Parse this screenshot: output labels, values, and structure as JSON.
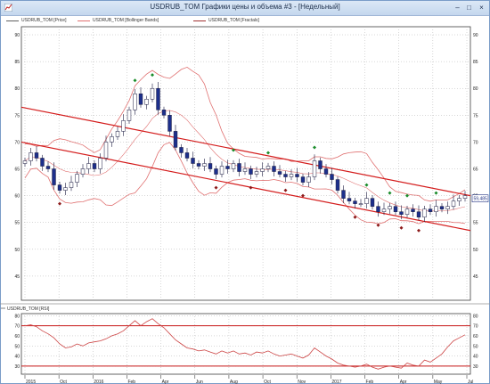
{
  "window": {
    "title": "USDRUB_TOM Графики цены и объема #3 - [Недельный]",
    "buttons": {
      "minimize": "–",
      "maximize": "□",
      "close": "×"
    }
  },
  "legend": {
    "price": "USDRUB_TOM [Price]",
    "bollinger": "USDRUB_TOM [Bollinger Bands]",
    "fractals": "USDRUB_TOM [Fractals]"
  },
  "rsi_panel": {
    "label": "USDRUB_TOM [RSI]",
    "levels": [
      70,
      30
    ]
  },
  "price_panel": {
    "last_price_label": "59,485"
  },
  "colors": {
    "candle_up": "#ffffff",
    "candle_down": "#1c2f8c",
    "bollinger": "#e07070",
    "trend": "#d41c1c",
    "fractal_up": "#1a8c2a",
    "fractal_down": "#8c1a1a",
    "rsi_line": "#cc4444",
    "rsi_levels": "#c81818"
  },
  "chart_data": [
    {
      "type": "candlestick",
      "title": "USDRUB_TOM",
      "y_ticks": [
        45,
        50,
        55,
        60,
        65,
        70,
        75,
        80,
        85,
        90
      ],
      "ylim": [
        40.5,
        91.5
      ],
      "x_ticks": [
        "2015",
        "Oct",
        "2016",
        "Feb",
        "Apr",
        "Jun",
        "Aug",
        "Oct",
        "Nov",
        "2017",
        "Feb",
        "Apr",
        "May",
        "Jul"
      ],
      "closes": [
        66.5,
        68,
        67,
        65.5,
        65,
        62,
        61,
        61.5,
        62.5,
        64,
        65,
        66,
        65,
        67,
        70,
        71,
        72,
        74,
        76,
        79,
        77,
        78,
        80,
        76,
        75,
        72,
        69,
        68,
        67,
        66,
        65.5,
        66,
        65,
        64,
        65.5,
        65,
        66,
        64.5,
        65,
        64,
        64.5,
        65,
        65.5,
        64.5,
        64,
        63.5,
        64,
        63.5,
        62.5,
        63.5,
        66.5,
        65,
        64,
        63,
        61,
        59.5,
        59,
        58.5,
        58.5,
        59.5,
        58,
        57,
        57.5,
        58,
        57,
        56.5,
        57.5,
        57,
        56,
        57.5,
        57,
        58,
        57.5,
        58,
        59,
        59.5,
        60
      ],
      "trend_upper": {
        "start": 76.5,
        "end": 60
      },
      "trend_lower": {
        "start": 70,
        "end": 53.5
      },
      "last_price": 59.485
    },
    {
      "type": "line",
      "title": "USDRUB_TOM [RSI]",
      "y_ticks": [
        30,
        40,
        50,
        60,
        70,
        80
      ],
      "ylim": [
        22,
        82
      ],
      "levels": [
        70,
        30
      ],
      "values": [
        70,
        71,
        69,
        65,
        62,
        58,
        52,
        48,
        49,
        52,
        50,
        53,
        54,
        55,
        57,
        60,
        62,
        65,
        70,
        75,
        70,
        74,
        77,
        72,
        68,
        62,
        56,
        52,
        48,
        47,
        45,
        46,
        44,
        42,
        45,
        43,
        45,
        42,
        43,
        41,
        44,
        43,
        45,
        42,
        40,
        41,
        42,
        40,
        38,
        41,
        48,
        44,
        40,
        37,
        33,
        31,
        30,
        29,
        30,
        32,
        29,
        27,
        29,
        30,
        29,
        28,
        33,
        31,
        30,
        36,
        34,
        38,
        42,
        49,
        55,
        58,
        61
      ]
    }
  ]
}
